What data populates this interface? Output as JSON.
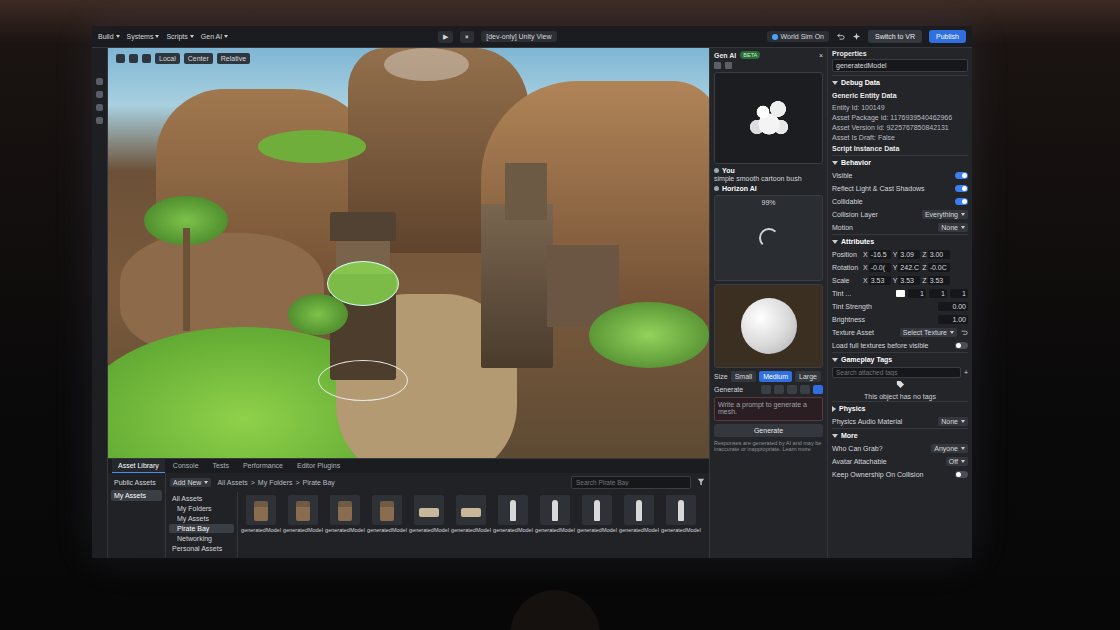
{
  "menu_bar": {
    "menus": [
      "Build",
      "Systems",
      "Scripts",
      "Gen AI"
    ],
    "play": "▶",
    "pause": "⏸",
    "view_label": "[dev-only] Unity View",
    "world_sim": "World Sim On",
    "switch_vr": "Switch to VR",
    "publish": "Publish"
  },
  "viewport_toolbar": {
    "items": [
      "Local",
      "Center",
      "Relative"
    ]
  },
  "gen_ai": {
    "title": "Gen AI",
    "badge": "BETA",
    "close": "×",
    "messages": [
      {
        "author": "You",
        "text": "simple smooth cartoon bush"
      },
      {
        "author": "Horizon AI",
        "progress": "99%"
      }
    ],
    "size_label": "Size",
    "sizes": [
      {
        "label": "Small",
        "selected": false
      },
      {
        "label": "Medium",
        "selected": true
      },
      {
        "label": "Large",
        "selected": false
      }
    ],
    "generate_label": "Generate",
    "types": [
      {
        "selected": false
      },
      {
        "selected": false
      },
      {
        "selected": false
      },
      {
        "selected": false
      },
      {
        "selected": true
      }
    ],
    "prompt_placeholder": "Write a prompt to generate a mesh.",
    "generate_button": "Generate",
    "disclaimer": "Responses are generated by AI and may be inaccurate or inappropriate. Learn more"
  },
  "properties": {
    "title": "Properties",
    "entity_name": "generatedModel",
    "rows": [
      {
        "kind": "section",
        "label": "Debug Data",
        "expanded": true
      },
      {
        "kind": "subheader",
        "label": "Generic Entity Data"
      },
      {
        "kind": "text",
        "label": "Entity Id: 100149"
      },
      {
        "kind": "text",
        "label": "Asset Package Id: 1176939540462966"
      },
      {
        "kind": "text",
        "label": "Asset Version Id: 9225767850842131"
      },
      {
        "kind": "text",
        "label": "Asset Is Draft: False"
      },
      {
        "kind": "subheader",
        "label": "Script Instance Data"
      },
      {
        "kind": "section",
        "label": "Behavior",
        "expanded": true
      },
      {
        "kind": "toggle",
        "label": "Visible",
        "on": true
      },
      {
        "kind": "toggle",
        "label": "Reflect Light & Cast Shadows",
        "on": true
      },
      {
        "kind": "toggle",
        "label": "Collidable",
        "on": true
      },
      {
        "kind": "dropdown",
        "label": "Collision Layer",
        "value": "Everything"
      },
      {
        "kind": "dropdown",
        "label": "Motion",
        "value": "None"
      },
      {
        "kind": "section",
        "label": "Attributes",
        "expanded": true
      },
      {
        "kind": "vector",
        "label": "Position",
        "axes": [
          {
            "axis": "X",
            "value": "-16.5"
          },
          {
            "axis": "Y",
            "value": "3.09"
          },
          {
            "axis": "Z",
            "value": "3.00"
          }
        ]
      },
      {
        "kind": "vector",
        "label": "Rotation",
        "axes": [
          {
            "axis": "X",
            "value": "-0.0("
          },
          {
            "axis": "Y",
            "value": "242.C"
          },
          {
            "axis": "Z",
            "value": "-0.0C"
          }
        ]
      },
      {
        "kind": "vector",
        "label": "Scale",
        "axes": [
          {
            "axis": "X",
            "value": "3.53"
          },
          {
            "axis": "Y",
            "value": "3.53"
          },
          {
            "axis": "Z",
            "value": "3.53"
          }
        ]
      },
      {
        "kind": "tint",
        "label": "Tint ...",
        "color": "#ffffff",
        "values": [
          "1",
          "1",
          "1"
        ]
      },
      {
        "kind": "value",
        "label": "Tint Strength",
        "value": "0.00"
      },
      {
        "kind": "value",
        "label": "Brightness",
        "value": "1.00"
      },
      {
        "kind": "dropdown",
        "label": "Texture Asset",
        "value": "Select Texture"
      },
      {
        "kind": "toggle",
        "label": "Load full textures before visible",
        "on": false
      },
      {
        "kind": "section",
        "label": "Gameplay Tags",
        "expanded": true
      },
      {
        "kind": "search",
        "placeholder": "Search attached tags",
        "icon": "+"
      },
      {
        "kind": "note",
        "label": "This object has no tags"
      },
      {
        "kind": "section",
        "label": "Physics",
        "expanded": false
      },
      {
        "kind": "dropdown",
        "label": "Physics Audio Material",
        "value": "None"
      },
      {
        "kind": "section",
        "label": "More",
        "expanded": true
      },
      {
        "kind": "dropdown",
        "label": "Who Can Grab?",
        "value": "Anyone"
      },
      {
        "kind": "dropdown",
        "label": "Avatar Attachable",
        "value": "Off"
      },
      {
        "kind": "toggle",
        "label": "Keep Ownership On Collision",
        "on": false
      }
    ]
  },
  "asset_library": {
    "tabs": [
      {
        "label": "Asset Library",
        "selected": true
      },
      {
        "label": "Console",
        "selected": false
      },
      {
        "label": "Tests",
        "selected": false
      },
      {
        "label": "Performance",
        "selected": false
      },
      {
        "label": "Editor Plugins",
        "selected": false
      }
    ],
    "sources": [
      {
        "label": "Public Assets",
        "selected": false
      },
      {
        "label": "My Assets",
        "selected": true
      }
    ],
    "add_new": "Add New",
    "breadcrumb": [
      "All Assets",
      ">",
      "My Folders",
      ">",
      "Pirate Bay"
    ],
    "search_placeholder": "Search Pirate Bay",
    "tree": [
      {
        "label": "All Assets",
        "selected": false
      },
      {
        "label": "My Folders",
        "selected": false
      },
      {
        "label": "My Assets",
        "selected": false
      },
      {
        "label": "Pirate Bay",
        "selected": true
      },
      {
        "label": "Networking",
        "selected": false
      },
      {
        "label": "Personal Assets",
        "selected": false
      }
    ],
    "assets": [
      {
        "label": "generatedModel",
        "kind": "building"
      },
      {
        "label": "generatedModel",
        "kind": "building"
      },
      {
        "label": "generatedModel",
        "kind": "building"
      },
      {
        "label": "generatedModel",
        "kind": "building"
      },
      {
        "label": "generatedModel",
        "kind": "furniture"
      },
      {
        "label": "generatedModel",
        "kind": "furniture"
      },
      {
        "label": "generatedModel",
        "kind": "figure"
      },
      {
        "label": "generatedModel",
        "kind": "figure"
      },
      {
        "label": "generatedModel",
        "kind": "figure"
      },
      {
        "label": "generatedModel",
        "kind": "figure"
      },
      {
        "label": "generatedModel",
        "kind": "figure"
      }
    ]
  }
}
